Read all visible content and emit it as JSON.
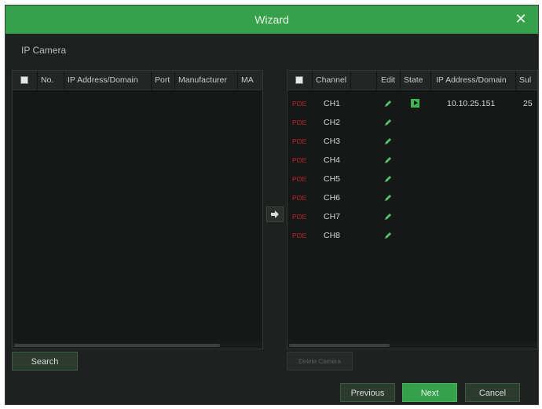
{
  "window": {
    "title": "Wizard",
    "close_glyph": "✕"
  },
  "section_label": "IP Camera",
  "left_table": {
    "headers": [
      "No.",
      "IP Address/Domain",
      "Port",
      "Manufacturer",
      "MA"
    ]
  },
  "right_table": {
    "headers": [
      "Channel",
      "",
      "Edit",
      "State",
      "IP Address/Domain",
      "Sul"
    ],
    "rows": [
      {
        "poe": "POE",
        "channel": "CH1",
        "state": "play",
        "ip": "10.10.25.151",
        "sub": "25"
      },
      {
        "poe": "POE",
        "channel": "CH2"
      },
      {
        "poe": "POE",
        "channel": "CH3"
      },
      {
        "poe": "POE",
        "channel": "CH4"
      },
      {
        "poe": "POE",
        "channel": "CH5"
      },
      {
        "poe": "POE",
        "channel": "CH6"
      },
      {
        "poe": "POE",
        "channel": "CH7"
      },
      {
        "poe": "POE",
        "channel": "CH8"
      }
    ]
  },
  "buttons": {
    "search": "Search",
    "delete": "Delete Camera",
    "previous": "Previous",
    "next": "Next",
    "cancel": "Cancel"
  },
  "colors": {
    "accent": "#36a04a",
    "poe": "#c2232d",
    "edit_icon": "#56c26a"
  },
  "icons": [
    "close-icon",
    "arrow-right-icon",
    "edit-pencil-icon",
    "play-state-icon",
    "checkbox-icon"
  ]
}
